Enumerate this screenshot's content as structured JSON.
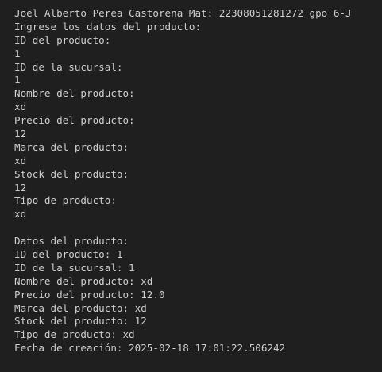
{
  "terminal": {
    "lines": [
      "Joel Alberto Perea Castorena Mat: 22308051281272 gpo 6-J",
      "Ingrese los datos del producto:",
      "ID del producto:",
      "1",
      "ID de la sucursal:",
      "1",
      "Nombre del producto:",
      "xd",
      "Precio del producto:",
      "12",
      "Marca del producto:",
      "xd",
      "Stock del producto:",
      "12",
      "Tipo de producto:",
      "xd",
      "",
      "Datos del producto:",
      "ID del producto: 1",
      "ID de la sucursal: 1",
      "Nombre del producto: xd",
      "Precio del producto: 12.0",
      "Marca del producto: xd",
      "Stock del producto: 12",
      "Tipo de producto: xd",
      "Fecha de creación: 2025-02-18 17:01:22.506242"
    ]
  }
}
